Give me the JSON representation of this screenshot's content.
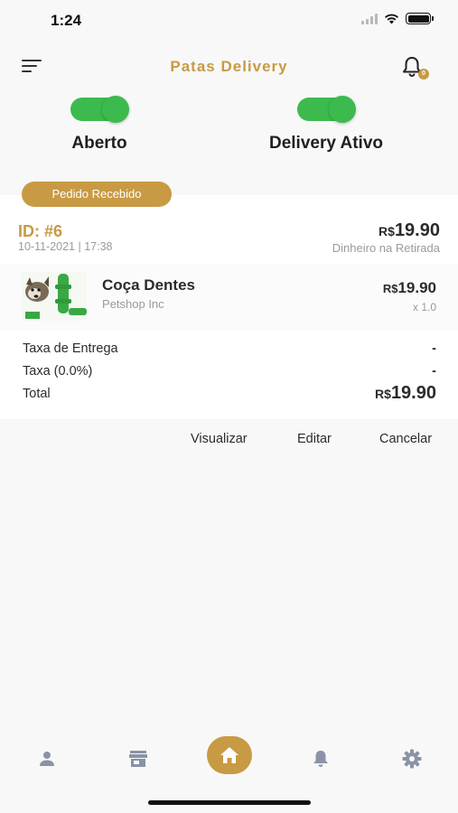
{
  "status_bar": {
    "time": "1:24"
  },
  "header": {
    "title": "Patas Delivery",
    "badge": "0"
  },
  "toggles": {
    "open_label": "Aberto",
    "delivery_label": "Delivery Ativo"
  },
  "order": {
    "status": "Pedido Recebido",
    "id": "ID: #6",
    "date": "10-11-2021 | 17:38",
    "currency": "R$",
    "total": "19.90",
    "payment": "Dinheiro na Retirada",
    "items": [
      {
        "name": "Coça Dentes",
        "shop": "Petshop Inc",
        "currency": "R$",
        "price": "19.90",
        "qty": "x 1.0"
      }
    ],
    "summary": {
      "delivery_fee_label": "Taxa de Entrega",
      "delivery_fee_value": "-",
      "tax_label": "Taxa (0.0%)",
      "tax_value": "-",
      "total_label": "Total",
      "total_currency": "R$",
      "total_value": "19.90"
    },
    "actions": {
      "view": "Visualizar",
      "edit": "Editar",
      "cancel": "Cancelar"
    }
  },
  "tab_bar": {
    "icons": [
      "person-icon",
      "store-icon",
      "home-icon",
      "bell-icon",
      "gear-icon"
    ],
    "active": "home-icon"
  },
  "colors": {
    "accent": "#c89a44",
    "toggle_on": "#3dba4e",
    "inactive_icon": "#8a93a6"
  }
}
